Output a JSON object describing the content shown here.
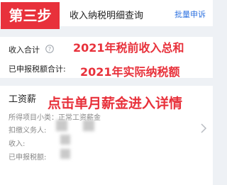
{
  "header": {
    "title": "收入纳税明细查询",
    "batch_label": "批量申诉"
  },
  "step_badge": "第三步",
  "summary": {
    "income_label": "收入合计",
    "tax_label": "已申报税额合计:"
  },
  "annotations": {
    "income_note": "2021年税前收入总和",
    "tax_note": "2021年实际纳税额",
    "detail_note": "点击单月薪金进入详情"
  },
  "detail": {
    "title": "工资薪",
    "project_label": "所得项目小类：正常工资薪金",
    "payer_label": "扣缴义务人:",
    "income_label": "收入:",
    "tax_label": "已申报税额:"
  },
  "colors": {
    "accent_red": "#e8313b",
    "link_blue": "#2f73e0",
    "background": "#eef1f5"
  }
}
